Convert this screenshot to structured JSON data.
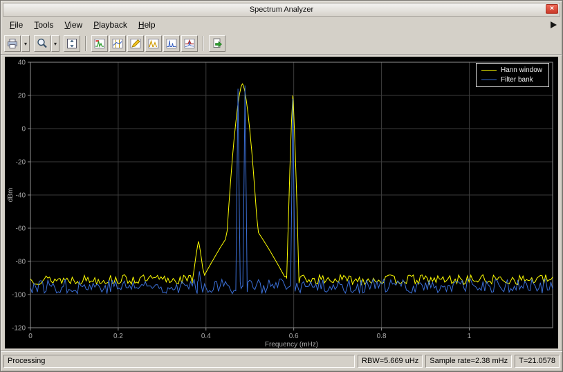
{
  "window": {
    "title": "Spectrum Analyzer",
    "close_label": "×"
  },
  "menu": {
    "items": [
      {
        "label": "File"
      },
      {
        "label": "Tools"
      },
      {
        "label": "View"
      },
      {
        "label": "Playback"
      },
      {
        "label": "Help"
      }
    ]
  },
  "toolbar": {
    "buttons": [
      "print",
      "print-dropdown",
      "zoom",
      "zoom-dropdown",
      "span-full-view",
      "spectrum-settings",
      "cursor-measurements",
      "channel-measurements",
      "peak-finder",
      "distortion-measurements",
      "spectral-mask",
      "export"
    ],
    "dropdown_glyph": "▾"
  },
  "chart_data": {
    "type": "line",
    "title": "",
    "xlabel": "Frequency (mHz)",
    "ylabel": "dBm",
    "xlim": [
      0,
      1.19
    ],
    "ylim": [
      -120,
      40
    ],
    "xticks": [
      0,
      0.2,
      0.4,
      0.6,
      0.8,
      1
    ],
    "yticks": [
      40,
      20,
      0,
      -20,
      -40,
      -60,
      -80,
      -100,
      -120
    ],
    "background": "#000000",
    "grid_color": "#3d3d3d",
    "axis_color": "#909090",
    "tick_color": "#a8a8a8",
    "grid": true,
    "legend_position": "top-right",
    "series": [
      {
        "name": "Hann window",
        "color": "#ffff00",
        "noise_floor": -91,
        "noise_amp": 3,
        "seed": 13,
        "peaks": [
          {
            "x": 0.383,
            "y": -68,
            "w": 0.014,
            "shape": 1.2
          },
          {
            "x": 0.483,
            "y": 27,
            "w": 0.042,
            "shape": 1.6
          },
          {
            "x": 0.487,
            "y": -52,
            "w": 0.1,
            "shape": 1.2
          },
          {
            "x": 0.598,
            "y": 20,
            "w": 0.014,
            "shape": 1.3
          }
        ]
      },
      {
        "name": "Filter bank",
        "color": "#3b6fd6",
        "noise_floor": -95,
        "noise_amp": 4.5,
        "seed": 77,
        "peaks": [
          {
            "x": 0.385,
            "y": -86,
            "w": 0.005,
            "shape": 1
          },
          {
            "x": 0.473,
            "y": 24,
            "w": 0.005,
            "shape": 1
          },
          {
            "x": 0.489,
            "y": 26,
            "w": 0.005,
            "shape": 1
          },
          {
            "x": 0.598,
            "y": 18,
            "w": 0.005,
            "shape": 1
          }
        ]
      }
    ]
  },
  "status_bar": {
    "left": "Processing",
    "fields": [
      "RBW=5.669 uHz",
      "Sample rate=2.38 mHz",
      "T=21.0578"
    ]
  }
}
